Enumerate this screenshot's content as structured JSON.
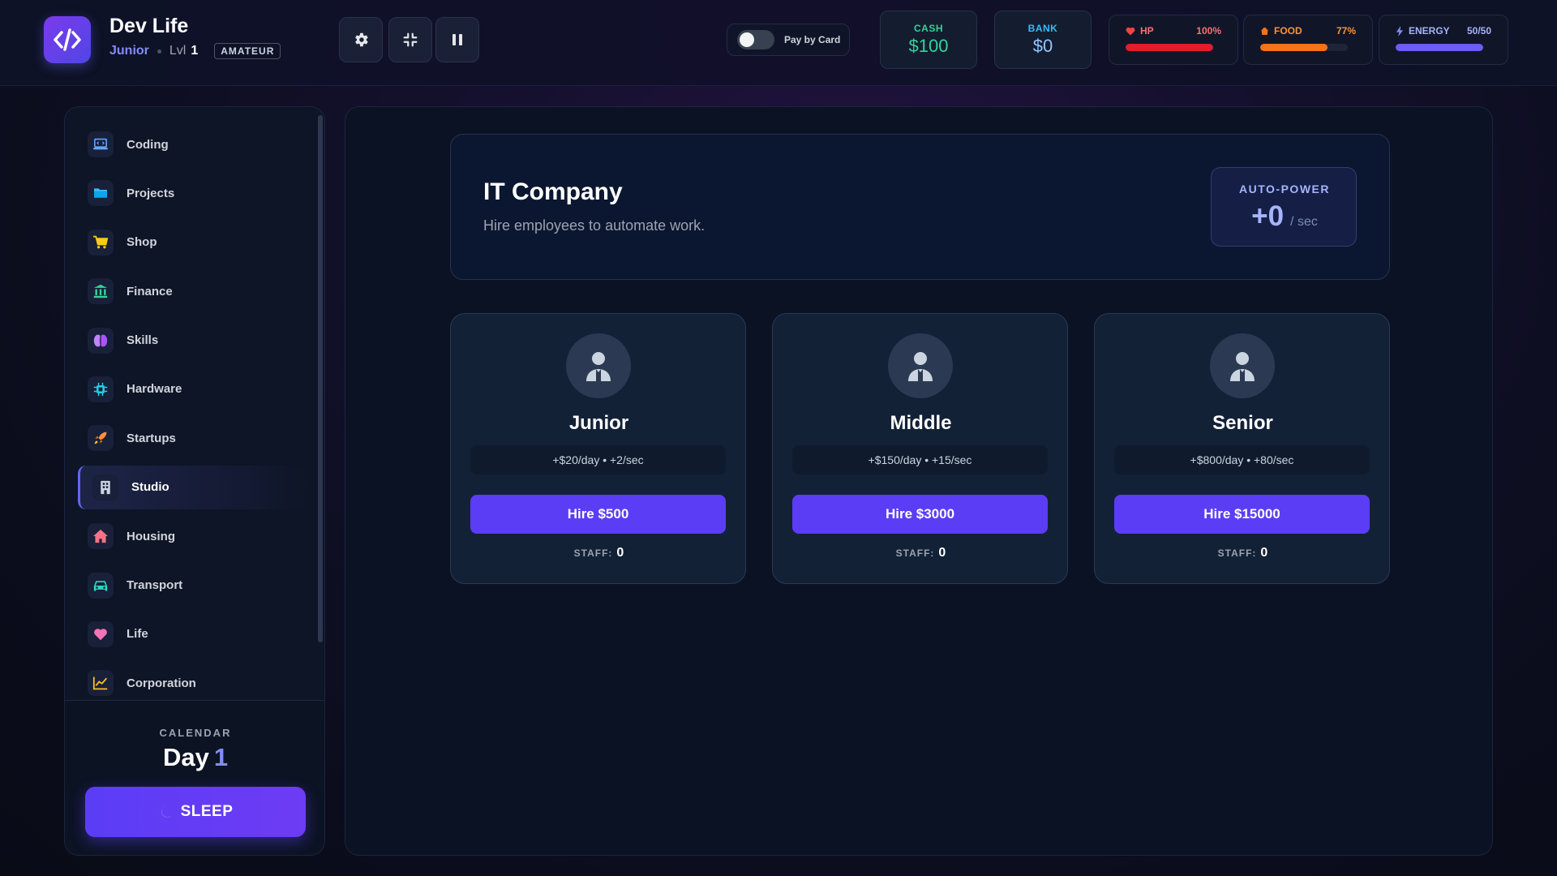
{
  "app": {
    "title": "Dev Life",
    "rank": "Junior",
    "level_label": "Lvl",
    "level": "1",
    "badge": "AMATEUR"
  },
  "toolbar": {
    "settings_icon": "gear-icon",
    "minimize_icon": "compress-icon",
    "pause_icon": "pause-icon"
  },
  "payment_toggle": {
    "label": "Pay by Card",
    "enabled": false
  },
  "wallet": {
    "cash_label": "CASH",
    "cash_value": "$100",
    "bank_label": "BANK",
    "bank_value": "$0"
  },
  "stats": {
    "hp": {
      "label": "HP",
      "value": "100%",
      "level": 1.0,
      "color": "#e11d2e",
      "icon": "heart-icon"
    },
    "food": {
      "label": "FOOD",
      "value": "77%",
      "level": 0.77,
      "color": "#f97316",
      "icon": "food-icon"
    },
    "energy": {
      "label": "ENERGY",
      "value": "50/50",
      "level": 1.0,
      "color": "#6d5cf5",
      "icon": "bolt-icon"
    }
  },
  "sidebar": {
    "items": [
      {
        "label": "Coding",
        "icon": "laptop-icon",
        "color": "#60a5fa"
      },
      {
        "label": "Projects",
        "icon": "folder-icon",
        "color": "#38bdf8"
      },
      {
        "label": "Shop",
        "icon": "cart-icon",
        "color": "#facc15"
      },
      {
        "label": "Finance",
        "icon": "bank-icon",
        "color": "#34d399"
      },
      {
        "label": "Skills",
        "icon": "brain-icon",
        "color": "#c084fc"
      },
      {
        "label": "Hardware",
        "icon": "chip-icon",
        "color": "#22d3ee"
      },
      {
        "label": "Startups",
        "icon": "rocket-icon",
        "color": "#fb923c"
      },
      {
        "label": "Studio",
        "icon": "building-icon",
        "color": "#cbd5e1",
        "active": true
      },
      {
        "label": "Housing",
        "icon": "house-icon",
        "color": "#fb7185"
      },
      {
        "label": "Transport",
        "icon": "car-icon",
        "color": "#2dd4bf"
      },
      {
        "label": "Life",
        "icon": "heart-icon",
        "color": "#f472b6"
      },
      {
        "label": "Corporation",
        "icon": "chart-icon",
        "color": "#fbbf24"
      }
    ],
    "calendar_label": "CALENDAR",
    "day_label": "Day",
    "day_value": "1",
    "sleep_label": "SLEEP",
    "sleep_icon": "moon-icon"
  },
  "company": {
    "title": "IT Company",
    "subtitle": "Hire employees to automate work.",
    "auto_power_label": "AUTO-POWER",
    "auto_power_value": "+0",
    "auto_power_unit": "/ sec"
  },
  "employees": [
    {
      "name": "Junior",
      "rate": "+$20/day • +2/sec",
      "hire_label": "Hire $500",
      "staff_label": "STAFF:",
      "staff_count": "0",
      "icon": "user-icon"
    },
    {
      "name": "Middle",
      "rate": "+$150/day • +15/sec",
      "hire_label": "Hire $3000",
      "staff_label": "STAFF:",
      "staff_count": "0",
      "icon": "user-icon"
    },
    {
      "name": "Senior",
      "rate": "+$800/day • +80/sec",
      "hire_label": "Hire $15000",
      "staff_label": "STAFF:",
      "staff_count": "0",
      "icon": "user-icon"
    }
  ]
}
